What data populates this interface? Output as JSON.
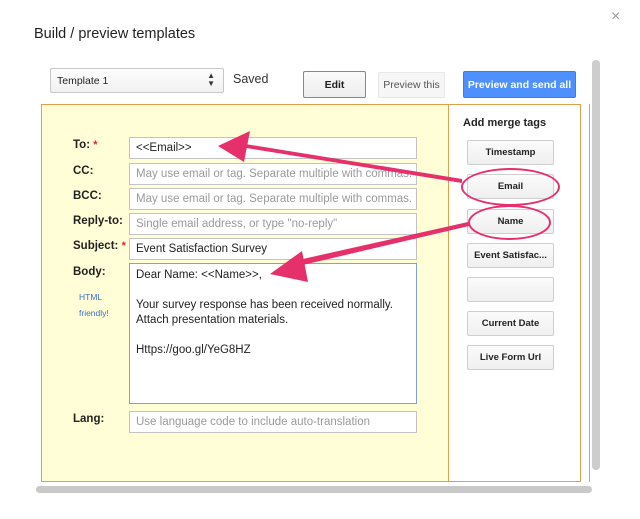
{
  "dialog": {
    "title": "Build / preview templates",
    "close_glyph": "×"
  },
  "toolbar": {
    "template_select": "Template 1",
    "status": "Saved",
    "edit_label": "Edit",
    "preview_label": "Preview this",
    "send_label": "Preview and send all"
  },
  "form": {
    "to": {
      "label": "To:",
      "required_mark": "*",
      "value": "<<Email>>"
    },
    "cc": {
      "label": "CC:",
      "placeholder": "May use email or tag. Separate multiple with commas."
    },
    "bcc": {
      "label": "BCC:",
      "placeholder": "May use email or tag. Separate multiple with commas."
    },
    "reply_to": {
      "label": "Reply-to:",
      "placeholder": "Single email address, or type \"no-reply\""
    },
    "subject": {
      "label": "Subject:",
      "required_mark": "*",
      "value": "Event Satisfaction Survey"
    },
    "body": {
      "label": "Body:",
      "html_note_1": "HTML",
      "html_note_2": "friendly!",
      "lines": [
        "Dear Name: <<Name>>,",
        "",
        "Your survey response has been received normally.",
        "Attach presentation materials.",
        "",
        "Https://goo.gl/YeG8HZ"
      ]
    },
    "lang": {
      "label": "Lang:",
      "placeholder": "Use language code to include auto-translation"
    }
  },
  "merge_tags": {
    "title": "Add merge tags",
    "items": [
      "Timestamp",
      "Email",
      "Name",
      "Event Satisfac...",
      "",
      "Current Date",
      "Live Form Url"
    ]
  },
  "colors": {
    "accent_blue": "#4d90fe",
    "panel_border": "#e1a04a",
    "panel_bg": "#fffed6",
    "annotation": "#e6306c"
  }
}
